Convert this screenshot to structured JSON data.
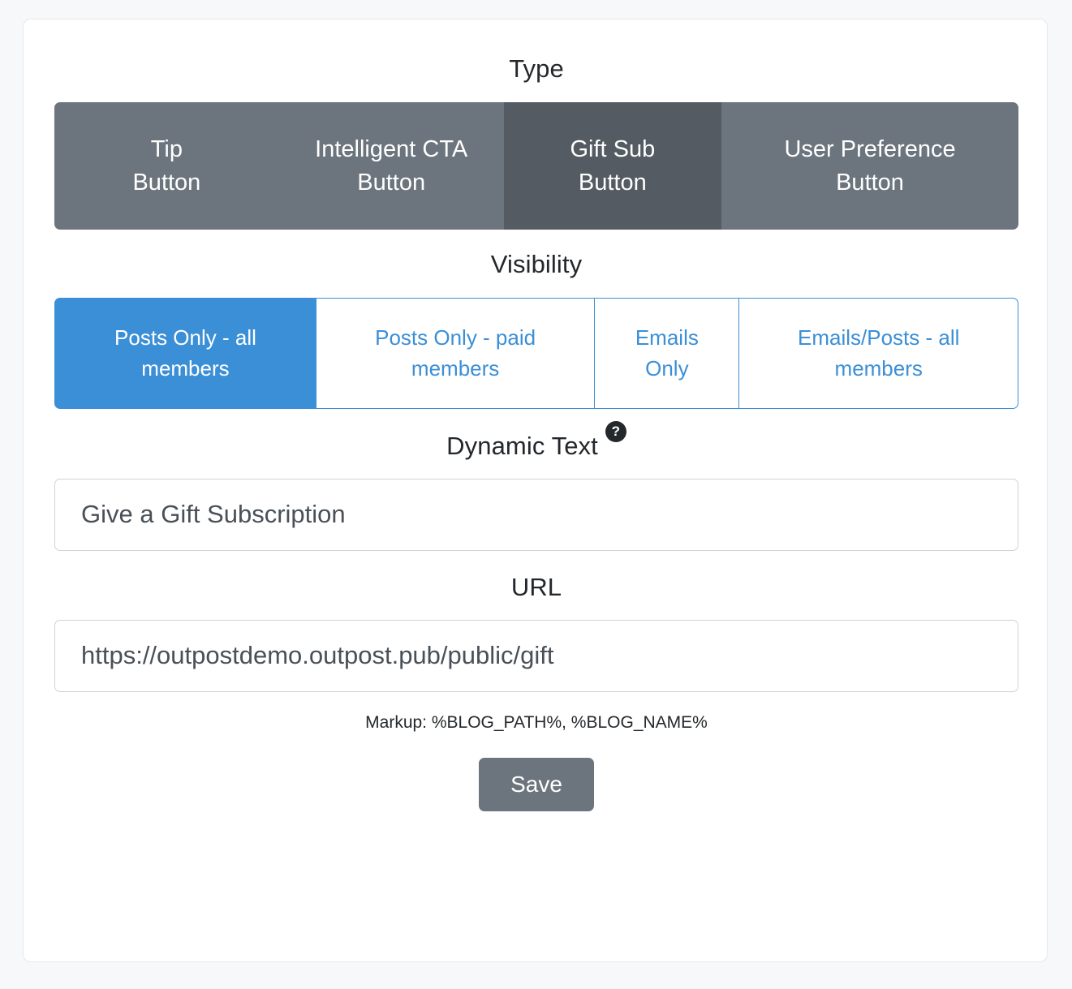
{
  "card": {
    "sections": {
      "type": {
        "heading": "Type",
        "options": [
          {
            "line1": "Tip",
            "line2": "Button",
            "active": false
          },
          {
            "line1": "Intelligent CTA",
            "line2": "Button",
            "active": false
          },
          {
            "line1": "Gift Sub",
            "line2": "Button",
            "active": true
          },
          {
            "line1": "User Preference",
            "line2": "Button",
            "active": false
          }
        ]
      },
      "visibility": {
        "heading": "Visibility",
        "options": [
          {
            "line1": "Posts Only - all",
            "line2": "members",
            "active": true
          },
          {
            "line1": "Posts Only - paid",
            "line2": "members",
            "active": false
          },
          {
            "line1": "Emails",
            "line2": "Only",
            "active": false
          },
          {
            "line1": "Emails/Posts - all",
            "line2": "members",
            "active": false
          }
        ]
      },
      "dynamic_text": {
        "heading": "Dynamic Text",
        "help_icon": "question-mark-icon",
        "help_icon_glyph": "?",
        "value": "Give a Gift Subscription",
        "placeholder": "Give a Gift Subscription"
      },
      "url": {
        "heading": "URL",
        "value": "https://outpostdemo.outpost.pub/public/gift",
        "placeholder": "https://outpostdemo.outpost.pub/public/gift",
        "markup_hint": "Markup: %BLOG_PATH%, %BLOG_NAME%"
      },
      "actions": {
        "save_label": "Save"
      }
    }
  },
  "colors": {
    "page_background": "#f7f8fa",
    "card_background": "#ffffff",
    "card_border": "#e6e8ea",
    "secondary": "#6c757d",
    "secondary_active": "#545b62",
    "primary": "#3b8fd6",
    "input_border": "#ced4da",
    "heading_text": "#24282c",
    "input_text": "#495057"
  }
}
